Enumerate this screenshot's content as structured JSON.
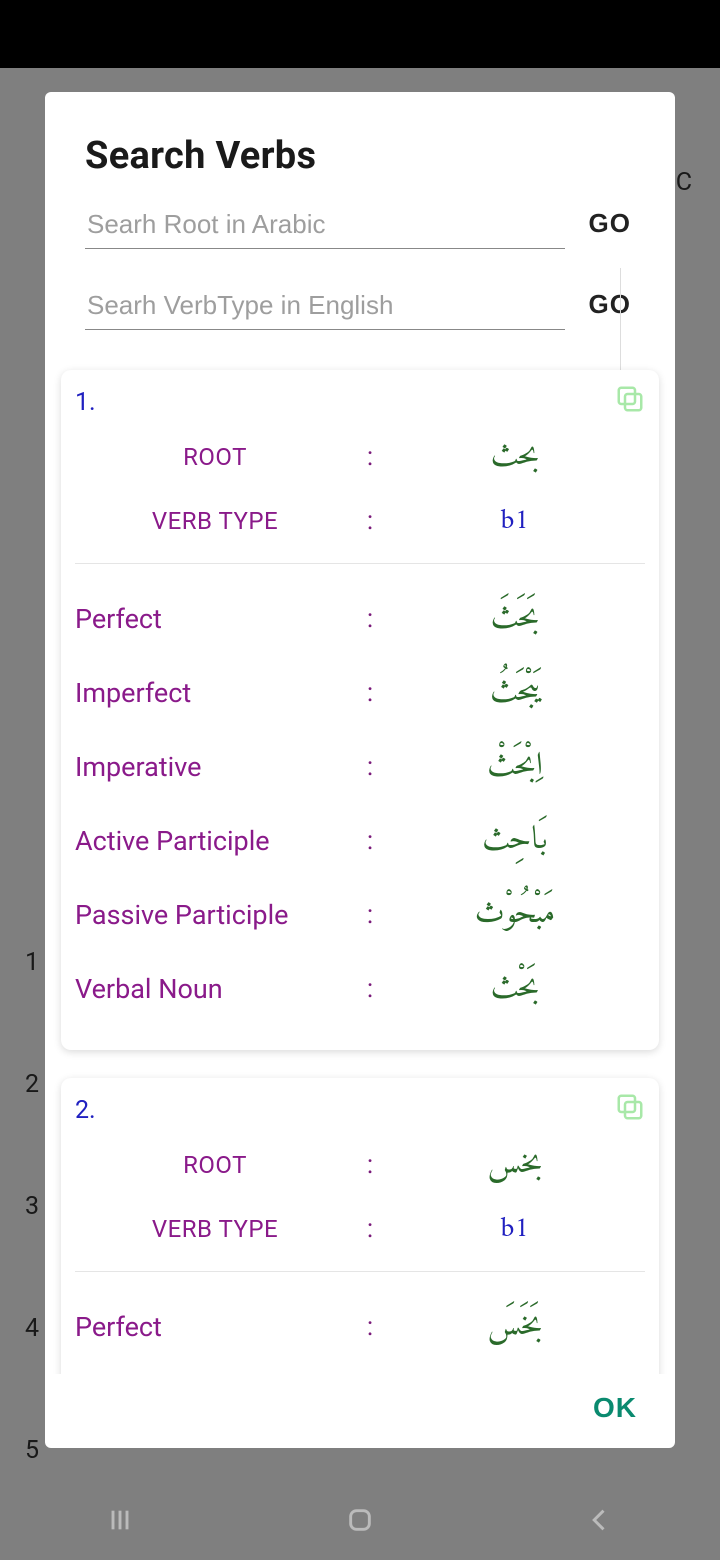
{
  "dialog": {
    "title": "Search Verbs",
    "search1_placeholder": "Searh Root in Arabic",
    "search2_placeholder": "Searh VerbType in English",
    "go_label": "GO",
    "ok_label": "OK"
  },
  "labels": {
    "root": "ROOT",
    "verb_type": "VERB TYPE",
    "perfect": "Perfect",
    "imperfect": "Imperfect",
    "imperative": "Imperative",
    "active_participle": "Active Participle",
    "passive_participle": "Passive Participle",
    "verbal_noun": "Verbal Noun"
  },
  "results": [
    {
      "index": "1.",
      "root": "بحث",
      "verb_type": "b1",
      "perfect": "بَحَثَ",
      "imperfect": "يَبْحَثُ",
      "imperative": "اِبْحَثْ",
      "active_participle": "بَاحِث",
      "passive_participle": "مَبْحُوْث",
      "verbal_noun": "بَحْث"
    },
    {
      "index": "2.",
      "root": "بخس",
      "verb_type": "b1",
      "perfect": "بَخَسَ"
    }
  ],
  "bg": {
    "c": "C",
    "nums": [
      "1",
      "2",
      "3",
      "4",
      "5"
    ]
  }
}
